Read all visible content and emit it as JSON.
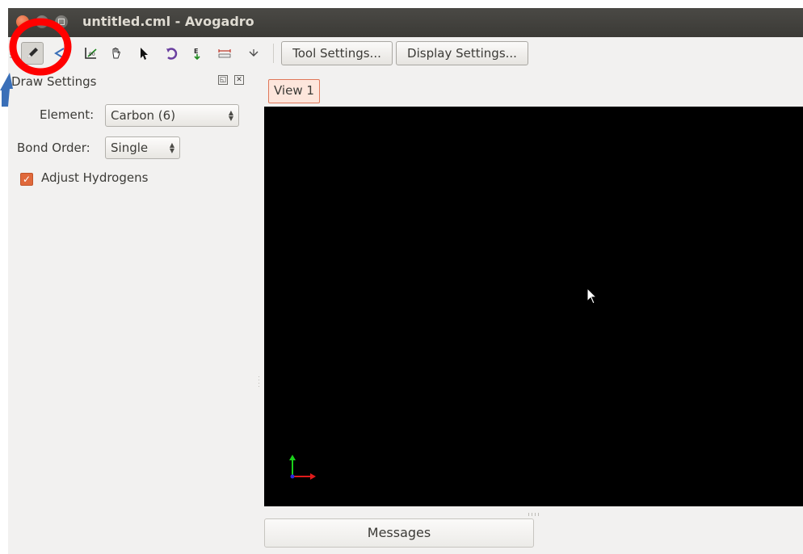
{
  "window": {
    "title": "untitled.cml - Avogadro"
  },
  "toolbar": {
    "tools": [
      {
        "name": "draw-tool",
        "icon": "pencil-icon",
        "active": true
      },
      {
        "name": "navigate-tool",
        "icon": "navigate-icon"
      },
      {
        "name": "bond-centric-tool",
        "icon": "angle-icon"
      },
      {
        "name": "manipulate-tool",
        "icon": "hand-icon"
      },
      {
        "name": "select-tool",
        "icon": "arrow-pointer-icon"
      },
      {
        "name": "auto-rotate-tool",
        "icon": "rotate-icon"
      },
      {
        "name": "auto-optimize-tool",
        "icon": "energy-icon"
      },
      {
        "name": "measure-tool",
        "icon": "ruler-icon"
      },
      {
        "name": "align-tool",
        "icon": "align-icon"
      }
    ],
    "tool_settings_label": "Tool Settings...",
    "display_settings_label": "Display Settings..."
  },
  "panel": {
    "title": "Draw Settings",
    "element_label": "Element:",
    "element_value": "Carbon (6)",
    "bond_order_label": "Bond Order:",
    "bond_order_value": "Single",
    "adjust_hydrogens_label": "Adjust Hydrogens",
    "adjust_hydrogens_checked": true
  },
  "view": {
    "tab_label": "View 1",
    "background": "#000000",
    "axes": {
      "x_color": "#e01b1b",
      "y_color": "#1bd01b",
      "z_color": "#2a2ae0"
    }
  },
  "messages": {
    "tab_label": "Messages"
  },
  "colors": {
    "accent": "#e0693b",
    "annotation_circle": "#ff0000",
    "annotation_arrow": "#3a6fb8"
  }
}
